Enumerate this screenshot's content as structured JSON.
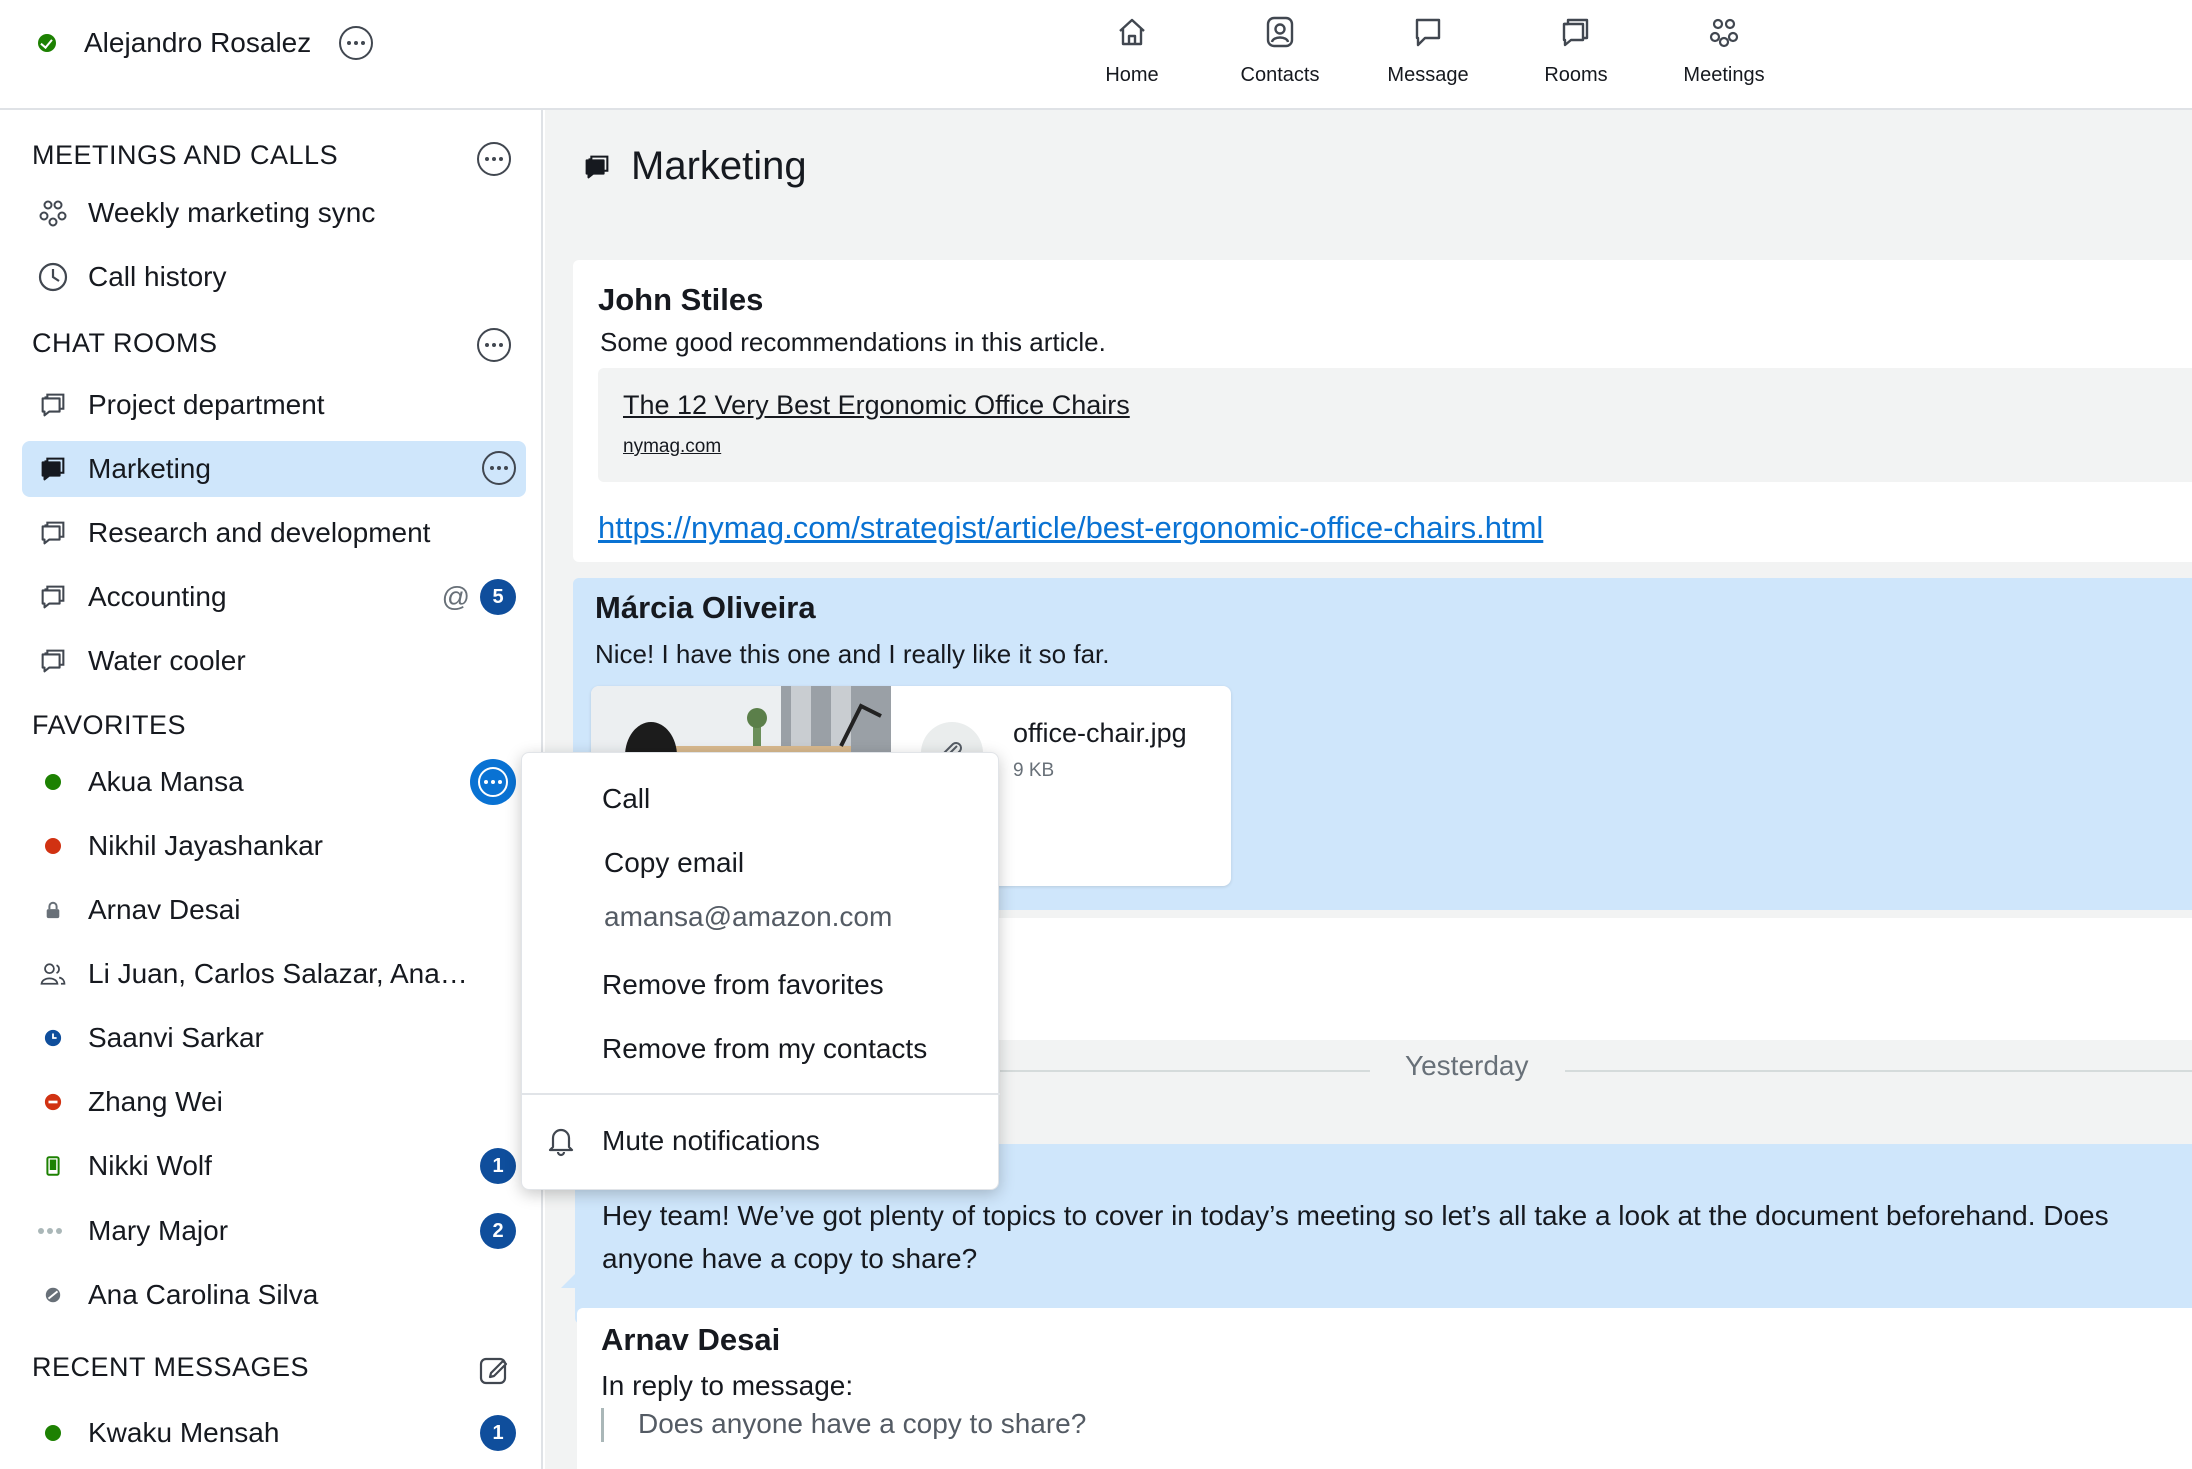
{
  "user": {
    "name": "Alejandro Rosalez",
    "status_color": "#1d8102"
  },
  "nav": [
    {
      "label": "Home",
      "icon": "home-icon"
    },
    {
      "label": "Contacts",
      "icon": "contacts-icon"
    },
    {
      "label": "Message",
      "icon": "message-icon"
    },
    {
      "label": "Rooms",
      "icon": "rooms-icon"
    },
    {
      "label": "Meetings",
      "icon": "meetings-icon"
    }
  ],
  "sidebar": {
    "meetings_title": "MEETINGS AND CALLS",
    "meetings": [
      {
        "label": "Weekly marketing sync",
        "icon": "meeting-icon"
      },
      {
        "label": "Call history",
        "icon": "clock-icon"
      }
    ],
    "rooms_title": "CHAT ROOMS",
    "rooms": [
      {
        "label": "Project department"
      },
      {
        "label": "Marketing",
        "selected": true
      },
      {
        "label": "Research and development"
      },
      {
        "label": "Accounting",
        "mention": "@",
        "badge": "5"
      },
      {
        "label": "Water cooler"
      }
    ],
    "favorites_title": "FAVORITES",
    "favorites": [
      {
        "label": "Akua Mansa",
        "status": "available",
        "status_color": "#1d8102"
      },
      {
        "label": "Nikhil Jayashankar",
        "status": "busy",
        "status_color": "#d13212"
      },
      {
        "label": "Arnav Desai",
        "status": "locked",
        "status_color": "#687078"
      },
      {
        "label": "Li Juan, Carlos Salazar, Ana…",
        "status": "group",
        "status_color": "#414750"
      },
      {
        "label": "Saanvi Sarkar",
        "status": "away",
        "status_color": "#0f4e9c"
      },
      {
        "label": "Zhang Wei",
        "status": "do-not-disturb",
        "status_color": "#d13212"
      },
      {
        "label": "Nikki Wolf",
        "status": "mobile",
        "status_color": "#1d8102",
        "badge": "1"
      },
      {
        "label": "Mary Major",
        "status": "offline",
        "status_color": "#aab7b8",
        "badge": "2"
      },
      {
        "label": "Ana Carolina Silva",
        "status": "invisible",
        "status_color": "#687078"
      }
    ],
    "recent_title": "RECENT MESSAGES",
    "recent": [
      {
        "label": "Kwaku Mensah",
        "status": "available",
        "status_color": "#1d8102",
        "badge": "1"
      }
    ]
  },
  "main": {
    "room_title": "Marketing",
    "messages": [
      {
        "sender": "John Stiles",
        "text": "Some good recommendations in this article.",
        "preview_title": "The 12 Very Best Ergonomic Office Chairs",
        "preview_domain": "nymag.com",
        "link": "https://nymag.com/strategist/article/best-ergonomic-office-chairs.html"
      },
      {
        "sender": "Márcia Oliveira",
        "text": "Nice! I have this one and I really like it so far.",
        "attachment_name": "office-chair.jpg",
        "attachment_size": "9 KB"
      },
      {
        "text": "Hey team! We’ve got plenty of topics to cover in today’s meeting so let’s all take a look at the document beforehand. Does anyone have a copy to share?"
      },
      {
        "sender": "Arnav Desai",
        "reply_label": "In reply to message:",
        "quote": "Does anyone have a copy to share?"
      }
    ],
    "divider_label": "Yesterday"
  },
  "context_menu": {
    "call": "Call",
    "copy_email": "Copy email",
    "email": "amansa@amazon.com",
    "remove_favorites": "Remove from favorites",
    "remove_contacts": "Remove from my contacts",
    "mute": "Mute notifications"
  },
  "colors": {
    "accent": "#0972d3",
    "selected_bg": "#cfe6fb",
    "badge": "#0f4e9c"
  }
}
